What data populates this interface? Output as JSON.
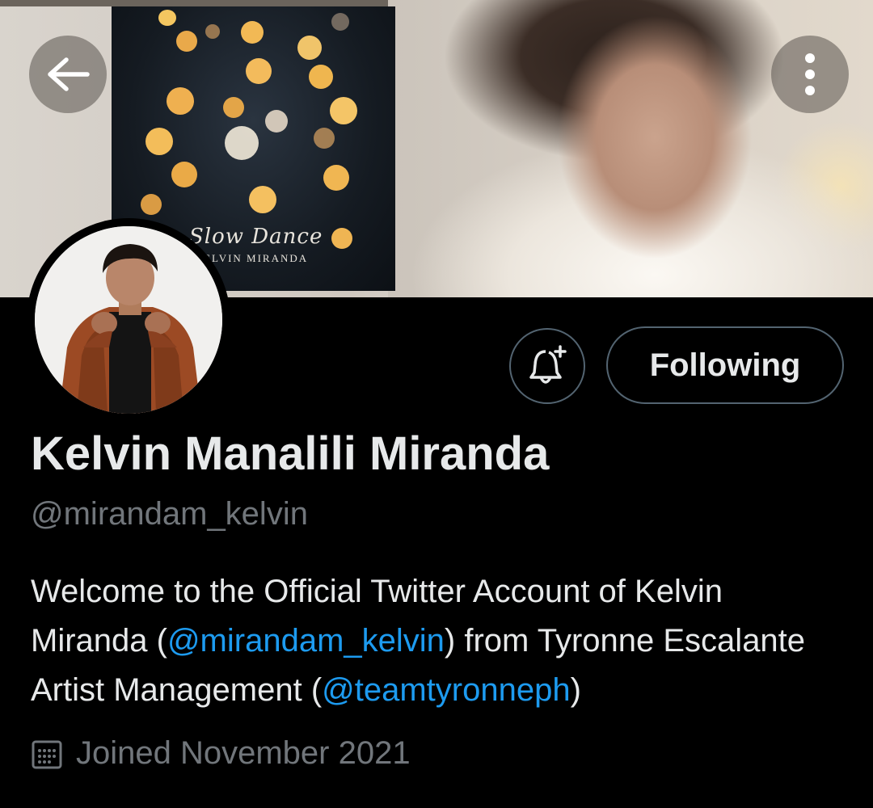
{
  "banner": {
    "album_title": "Slow Dance",
    "album_artist": "ELVIN MIRANDA"
  },
  "actions": {
    "following_label": "Following"
  },
  "profile": {
    "display_name": "Kelvin Manalili Miranda",
    "handle": "@mirandam_kelvin",
    "bio": {
      "part1": "Welcome to the Official Twitter Account of Kelvin Miranda (",
      "mention1": "@mirandam_kelvin",
      "part2": ") from Tyronne Escalante Artist Management (",
      "mention2": "@teamtyronneph",
      "part3": ")"
    },
    "joined": "Joined November 2021"
  },
  "icons": {
    "back": "arrow-left-icon",
    "more": "more-vertical-icon",
    "notify": "bell-plus-icon",
    "calendar": "calendar-icon"
  },
  "colors": {
    "background": "#000000",
    "text_primary": "#e7e9ea",
    "text_secondary": "#71767b",
    "link": "#1d9bf0",
    "button_border": "#536471"
  }
}
